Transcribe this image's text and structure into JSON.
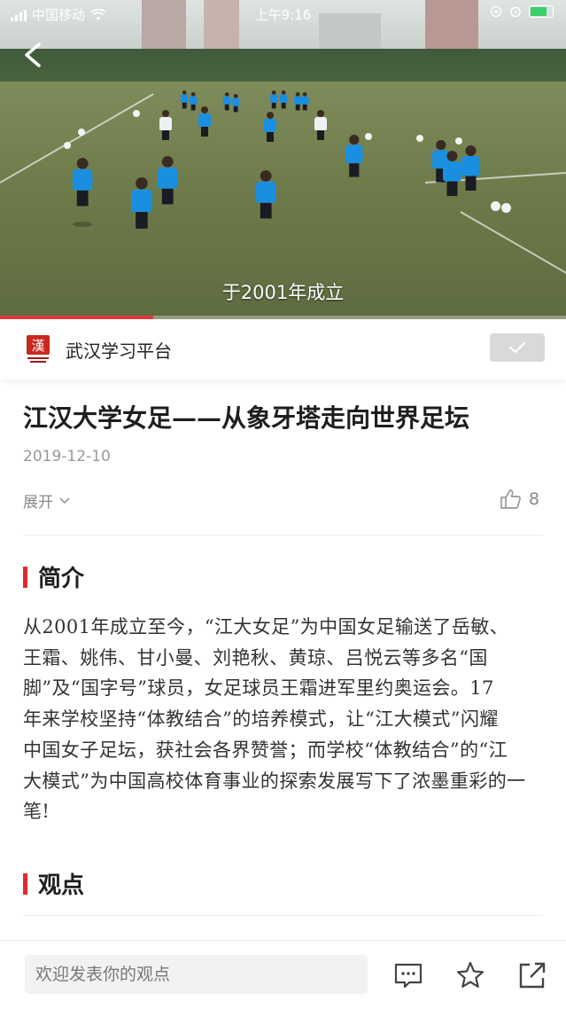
{
  "status_bar": {
    "carrier": "中国移动",
    "time": "上午9:16"
  },
  "video": {
    "subtitle": "于2001年成立",
    "progress": 0.27
  },
  "source": {
    "name": "武汉学习平台",
    "logo_text": "漢"
  },
  "article": {
    "title": "江汉大学女足——从象牙塔走向世界足坛",
    "date": "2019-12-10",
    "expand_label": "展开",
    "like_count": "8",
    "intro_heading": "简介",
    "intro_lines": [
      "从2001年成立至今，“江大女足”为中国女足输送了岳敏、",
      "王霜、姚伟、甘小曼、刘艳秋、黄琼、吕悦云等多名“国",
      "脚”及“国字号”球员，女足球员王霜进军里约奥运会。17",
      "年来学校坚持“体教结合”的培养模式，让“江大模式”闪耀",
      "中国女子足坛，获社会各界赞誉；而学校“体教结合”的“江",
      "大模式”为中国高校体育事业的探索发展写下了浓墨重彩的一",
      "笔!"
    ],
    "opinion_heading": "观点"
  },
  "bottom_bar": {
    "comment_placeholder": "欢迎发表你的观点"
  },
  "colors": {
    "accent": "#e12a2a",
    "follow_bg": "#d9d9d9",
    "battery": "#3cd06a"
  }
}
